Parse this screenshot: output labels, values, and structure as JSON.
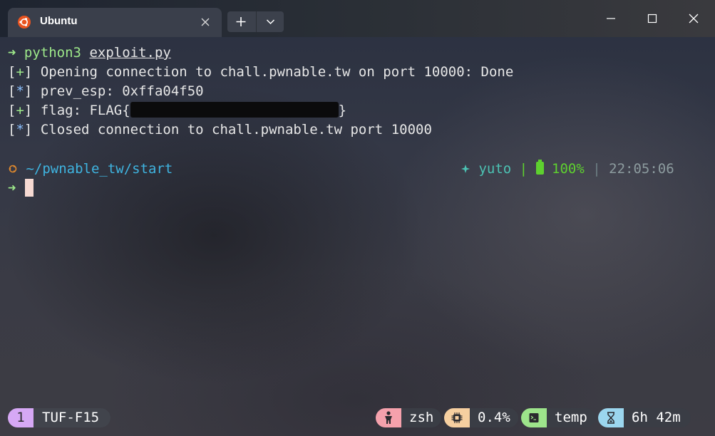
{
  "window": {
    "tab_title": "Ubuntu"
  },
  "terminal": {
    "lines": [
      {
        "prompt_arrow": "➜",
        "command": "python3",
        "arg": "exploit.py"
      },
      {
        "prefix": "[+]",
        "text": "Opening connection to chall.pwnable.tw on port 10000: Done"
      },
      {
        "prefix": "[*]",
        "text": "prev_esp: 0xffa04f50"
      },
      {
        "prefix": "[+]",
        "text": "flag: FLAG{",
        "suffix": "}"
      },
      {
        "prefix": "[*]",
        "text": "Closed connection to chall.pwnable.tw port 10000"
      }
    ],
    "prompt": {
      "path_home": "~/pwnable_tw/",
      "path_dir": "start",
      "user": "yuto",
      "separator": "|",
      "battery": "100%",
      "time": "22:05:06",
      "arrow": "➜"
    }
  },
  "statusbar": {
    "session_index": "1",
    "session_name": "TUF-F15",
    "shell": "zsh",
    "cpu": "0.4%",
    "dir": "temp",
    "uptime": "6h 42m"
  },
  "colors": {
    "ubuntu_orange": "#e95420",
    "prompt_green": "#9ee98a",
    "path_cyan": "#3fb4e0",
    "battery_green": "#5ed02f"
  },
  "icons": [
    "ubuntu-icon",
    "close-icon",
    "plus-icon",
    "chevron-down-icon",
    "minimize-icon",
    "maximize-icon",
    "window-close-icon",
    "os-icon",
    "user-icon",
    "battery-icon",
    "person-icon",
    "cpu-icon",
    "terminal-icon",
    "hourglass-icon"
  ]
}
